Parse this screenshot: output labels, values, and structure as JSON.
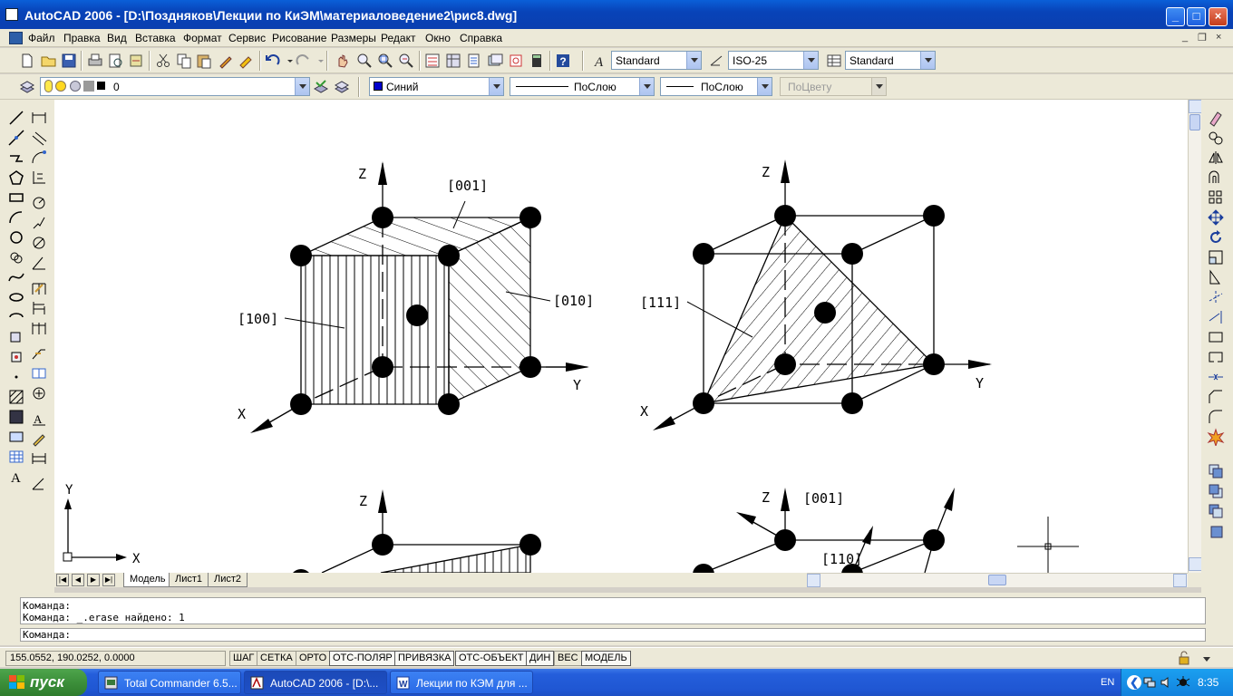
{
  "window": {
    "title": "AutoCAD 2006 - [D:\\Поздняков\\Лекции по КиЭМ\\материаловедение2\\рис8.dwg]"
  },
  "menu": {
    "items": [
      "Файл",
      "Правка",
      "Вид",
      "Вставка",
      "Формат",
      "Сервис",
      "Рисование",
      "Размеры",
      "Редакт",
      "Окно",
      "Справка"
    ]
  },
  "toolbar_standard": {
    "text_style": "Standard",
    "dim_style": "ISO-25",
    "table_style": "Standard"
  },
  "toolbar_layers": {
    "layer": "0",
    "color": "Синий",
    "color_swatch": "#0000cc",
    "linetype": "ПоСлою",
    "lineweight": "ПоСлою",
    "plotstyle": "ПоЦвету"
  },
  "drawing": {
    "ucs": {
      "y": "Y",
      "x": "X"
    },
    "fig1": {
      "z": "Z",
      "y": "Y",
      "x": "X",
      "label_001": "[001]",
      "label_010": "[010]",
      "label_100": "[100]"
    },
    "fig2": {
      "z": "Z",
      "y": "Y",
      "x": "X",
      "label_111": "[111]"
    },
    "fig3": {
      "z": "Z"
    },
    "fig4": {
      "z": "Z",
      "label_001": "[001]",
      "label_110": "[110]"
    }
  },
  "layout_tabs": [
    "Модель",
    "Лист1",
    "Лист2"
  ],
  "command": {
    "history": [
      "Команда:",
      "Команда: _.erase найдено: 1"
    ],
    "prompt": "Команда:"
  },
  "status": {
    "coords": "155.0552, 190.0252, 0.0000",
    "toggles": [
      "ШАГ",
      "СЕТКА",
      "ОРТО",
      "ОТС-ПОЛЯР",
      "ПРИВЯЗКА",
      "ОТС-ОБЪЕКТ",
      "ДИН",
      "ВЕС",
      "МОДЕЛЬ"
    ]
  },
  "taskbar": {
    "start": "пуск",
    "tasks": [
      "Total Commander 6.5...",
      "AutoCAD 2006 - [D:\\...",
      "Лекции по КЭМ для ..."
    ],
    "lang": "EN",
    "time": "8:35"
  }
}
